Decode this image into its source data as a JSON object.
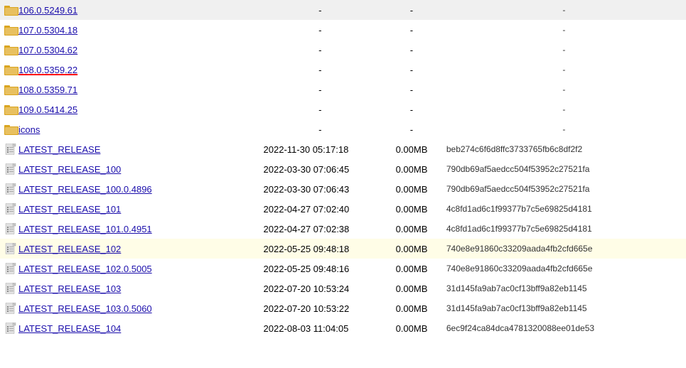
{
  "rows": [
    {
      "type": "folder",
      "name": "106.0.5249.61",
      "date": "-",
      "size": "-",
      "hash": "-",
      "redUnderline": false
    },
    {
      "type": "folder",
      "name": "107.0.5304.18",
      "date": "-",
      "size": "-",
      "hash": "-",
      "redUnderline": false
    },
    {
      "type": "folder",
      "name": "107.0.5304.62",
      "date": "-",
      "size": "-",
      "hash": "-",
      "redUnderline": false
    },
    {
      "type": "folder",
      "name": "108.0.5359.22",
      "date": "-",
      "size": "-",
      "hash": "-",
      "redUnderline": true
    },
    {
      "type": "folder",
      "name": "108.0.5359.71",
      "date": "-",
      "size": "-",
      "hash": "-",
      "redUnderline": false
    },
    {
      "type": "folder",
      "name": "109.0.5414.25",
      "date": "-",
      "size": "-",
      "hash": "-",
      "redUnderline": false
    },
    {
      "type": "folder",
      "name": "icons",
      "date": "-",
      "size": "-",
      "hash": "-",
      "redUnderline": false
    },
    {
      "type": "file",
      "name": "LATEST_RELEASE",
      "date": "2022-11-30 05:17:18",
      "size": "0.00MB",
      "hash": "beb274c6f6d8ffc3733765fb6c8df2f2",
      "redUnderline": false
    },
    {
      "type": "file",
      "name": "LATEST_RELEASE_100",
      "date": "2022-03-30 07:06:45",
      "size": "0.00MB",
      "hash": "790db69af5aedcc504f53952c27521fa",
      "redUnderline": false
    },
    {
      "type": "file",
      "name": "LATEST_RELEASE_100.0.4896",
      "date": "2022-03-30 07:06:43",
      "size": "0.00MB",
      "hash": "790db69af5aedcc504f53952c27521fa",
      "redUnderline": false
    },
    {
      "type": "file",
      "name": "LATEST_RELEASE_101",
      "date": "2022-04-27 07:02:40",
      "size": "0.00MB",
      "hash": "4c8fd1ad6c1f99377b7c5e69825d4181",
      "redUnderline": false
    },
    {
      "type": "file",
      "name": "LATEST_RELEASE_101.0.4951",
      "date": "2022-04-27 07:02:38",
      "size": "0.00MB",
      "hash": "4c8fd1ad6c1f99377b7c5e69825d4181",
      "redUnderline": false
    },
    {
      "type": "file",
      "name": "LATEST_RELEASE_102",
      "date": "2022-05-25 09:48:18",
      "size": "0.00MB",
      "hash": "740e8e91860c33209aada4fb2cfd665e",
      "redUnderline": false,
      "highlighted": true
    },
    {
      "type": "file",
      "name": "LATEST_RELEASE_102.0.5005",
      "date": "2022-05-25 09:48:16",
      "size": "0.00MB",
      "hash": "740e8e91860c33209aada4fb2cfd665e",
      "redUnderline": false
    },
    {
      "type": "file",
      "name": "LATEST_RELEASE_103",
      "date": "2022-07-20 10:53:24",
      "size": "0.00MB",
      "hash": "31d145fa9ab7ac0cf13bff9a82eb1145",
      "redUnderline": false
    },
    {
      "type": "file",
      "name": "LATEST_RELEASE_103.0.5060",
      "date": "2022-07-20 10:53:22",
      "size": "0.00MB",
      "hash": "31d145fa9ab7ac0cf13bff9a82eb1145",
      "redUnderline": false
    },
    {
      "type": "file",
      "name": "LATEST_RELEASE_104",
      "date": "2022-08-03 11:04:05",
      "size": "0.00MB",
      "hash": "6ec9f24ca84dca4781320088ee01de53",
      "redUnderline": false
    }
  ],
  "colors": {
    "folder": "#DAA520",
    "file_bg": "#f5f5f5",
    "link": "#1a0dab",
    "highlight_bg": "#fffde7"
  }
}
